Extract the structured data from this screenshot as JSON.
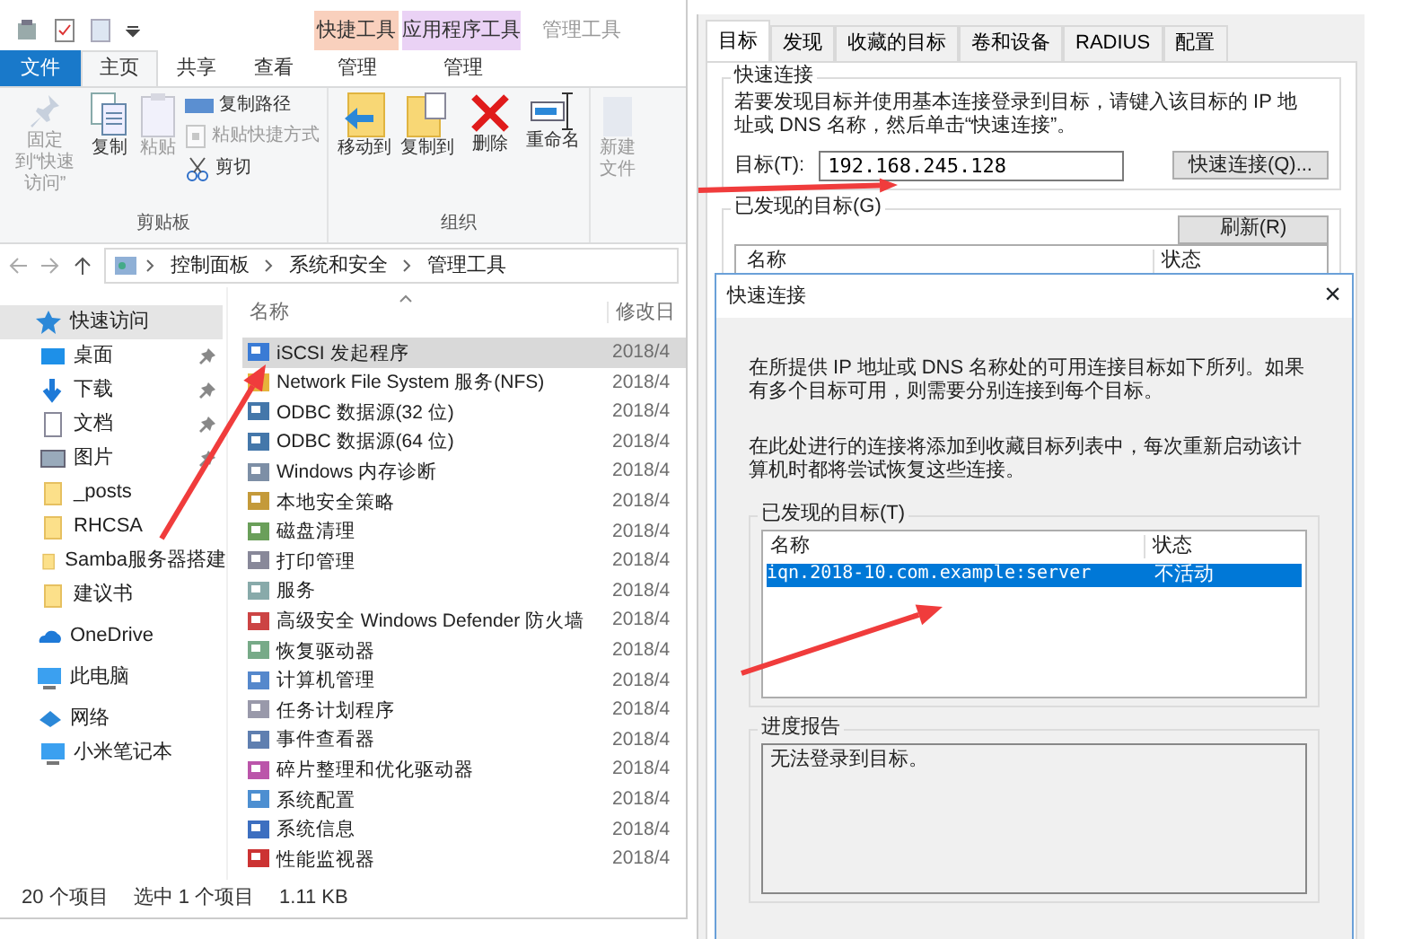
{
  "explorer": {
    "title": "管理工具",
    "context_groups": [
      {
        "label": "快捷工具",
        "color": "#f9d0bd"
      },
      {
        "label": "应用程序工具",
        "color": "#ead2f5"
      }
    ],
    "ribbon_tabs": [
      {
        "label": "文件",
        "kind": "file",
        "selected": false
      },
      {
        "label": "主页",
        "kind": "tab",
        "selected": true
      },
      {
        "label": "共享",
        "kind": "tab",
        "selected": false
      },
      {
        "label": "查看",
        "kind": "tab",
        "selected": false
      },
      {
        "label": "管理",
        "kind": "tab",
        "selected": false
      },
      {
        "label": "管理",
        "kind": "tab",
        "selected": false
      }
    ],
    "ribbon_groups": [
      {
        "label": "剪贴板",
        "commands": [
          {
            "label": "固定到“快速访问”",
            "kind": "large",
            "disabled": true
          },
          {
            "label": "复制",
            "kind": "large",
            "disabled": false
          },
          {
            "label": "粘贴",
            "kind": "large",
            "disabled": true
          },
          {
            "label": "复制路径",
            "kind": "small",
            "disabled": false
          },
          {
            "label": "粘贴快捷方式",
            "kind": "small",
            "disabled": true
          },
          {
            "label": "剪切",
            "kind": "small",
            "disabled": false
          }
        ]
      },
      {
        "label": "组织",
        "commands": [
          {
            "label": "移动到",
            "kind": "large",
            "disabled": false
          },
          {
            "label": "复制到",
            "kind": "large",
            "disabled": false
          },
          {
            "label": "删除",
            "kind": "large",
            "disabled": false
          },
          {
            "label": "重命名",
            "kind": "large",
            "disabled": false
          }
        ]
      },
      {
        "commands": [
          {
            "label": "新建文件",
            "kind": "large",
            "disabled": true
          }
        ]
      }
    ],
    "breadcrumb": [
      "控制面板",
      "系统和安全",
      "管理工具"
    ],
    "nav": [
      {
        "label": "快速访问",
        "kind": "header",
        "selected": true,
        "pinned": false
      },
      {
        "label": "桌面",
        "kind": "sub",
        "selected": false,
        "pinned": true
      },
      {
        "label": "下载",
        "kind": "sub",
        "selected": false,
        "pinned": true
      },
      {
        "label": "文档",
        "kind": "sub",
        "selected": false,
        "pinned": true
      },
      {
        "label": "图片",
        "kind": "sub",
        "selected": false,
        "pinned": true
      },
      {
        "label": "_posts",
        "kind": "sub",
        "selected": false,
        "pinned": false
      },
      {
        "label": "RHCSA",
        "kind": "sub",
        "selected": false,
        "pinned": false
      },
      {
        "label": "Samba服务器搭建",
        "kind": "sub",
        "selected": false,
        "pinned": false
      },
      {
        "label": "建议书",
        "kind": "sub",
        "selected": false,
        "pinned": false
      },
      {
        "label": "OneDrive",
        "kind": "header",
        "selected": false,
        "pinned": false
      },
      {
        "label": "此电脑",
        "kind": "header",
        "selected": false,
        "pinned": false
      },
      {
        "label": "网络",
        "kind": "header",
        "selected": false,
        "pinned": false
      },
      {
        "label": "小米笔记本",
        "kind": "sub",
        "selected": false,
        "pinned": false
      }
    ],
    "columns": [
      "名称",
      "修改日"
    ],
    "files": [
      {
        "name": "iSCSI 发起程序",
        "date": "2018/4",
        "selected": true
      },
      {
        "name": "Network File System 服务(NFS)",
        "date": "2018/4",
        "selected": false
      },
      {
        "name": "ODBC 数据源(32 位)",
        "date": "2018/4",
        "selected": false
      },
      {
        "name": "ODBC 数据源(64 位)",
        "date": "2018/4",
        "selected": false
      },
      {
        "name": "Windows 内存诊断",
        "date": "2018/4",
        "selected": false
      },
      {
        "name": "本地安全策略",
        "date": "2018/4",
        "selected": false
      },
      {
        "name": "磁盘清理",
        "date": "2018/4",
        "selected": false
      },
      {
        "name": "打印管理",
        "date": "2018/4",
        "selected": false
      },
      {
        "name": "服务",
        "date": "2018/4",
        "selected": false
      },
      {
        "name": "高级安全 Windows Defender 防火墙",
        "date": "2018/4",
        "selected": false
      },
      {
        "name": "恢复驱动器",
        "date": "2018/4",
        "selected": false
      },
      {
        "name": "计算机管理",
        "date": "2018/4",
        "selected": false
      },
      {
        "name": "任务计划程序",
        "date": "2018/4",
        "selected": false
      },
      {
        "name": "事件查看器",
        "date": "2018/4",
        "selected": false
      },
      {
        "name": "碎片整理和优化驱动器",
        "date": "2018/4",
        "selected": false
      },
      {
        "name": "系统配置",
        "date": "2018/4",
        "selected": false
      },
      {
        "name": "系统信息",
        "date": "2018/4",
        "selected": false
      },
      {
        "name": "性能监视器",
        "date": "2018/4",
        "selected": false
      }
    ],
    "status": [
      "20 个项目",
      "选中 1 个项目",
      "1.11 KB"
    ]
  },
  "iscsi": {
    "tabs": [
      {
        "label": "目标",
        "selected": true
      },
      {
        "label": "发现",
        "selected": false
      },
      {
        "label": "收藏的目标",
        "selected": false
      },
      {
        "label": "卷和设备",
        "selected": false
      },
      {
        "label": "RADIUS",
        "selected": false
      },
      {
        "label": "配置",
        "selected": false
      }
    ],
    "quick_group": "快速连接",
    "quick_text": "若要发现目标并使用基本连接登录到目标，请键入该目标的 IP 地址或 DNS 名称，然后单击“快速连接”。",
    "target_label": "目标(T):",
    "target_value": "192.168.245.128",
    "connect_button": "快速连接(Q)...",
    "discovered_group": "已发现的目标(G)",
    "refresh_button": "刷新(R)",
    "columns": [
      "名称",
      "状态"
    ]
  },
  "quick_connect": {
    "title": "快速连接",
    "close": "×",
    "paragraphs": [
      "在所提供 IP 地址或 DNS 名称处的可用连接目标如下所列。如果有多个目标可用，则需要分别连接到每个目标。",
      "在此处进行的连接将添加到收藏目标列表中，每次重新启动该计算机时都将尝试恢复这些连接。"
    ],
    "targets_group": "已发现的目标(T)",
    "columns": [
      "名称",
      "状态"
    ],
    "targets": [
      {
        "name": "iqn.2018-10.com.example:server",
        "status": "不活动",
        "selected": true
      }
    ],
    "progress_group": "进度报告",
    "progress_text": "无法登录到目标。"
  }
}
